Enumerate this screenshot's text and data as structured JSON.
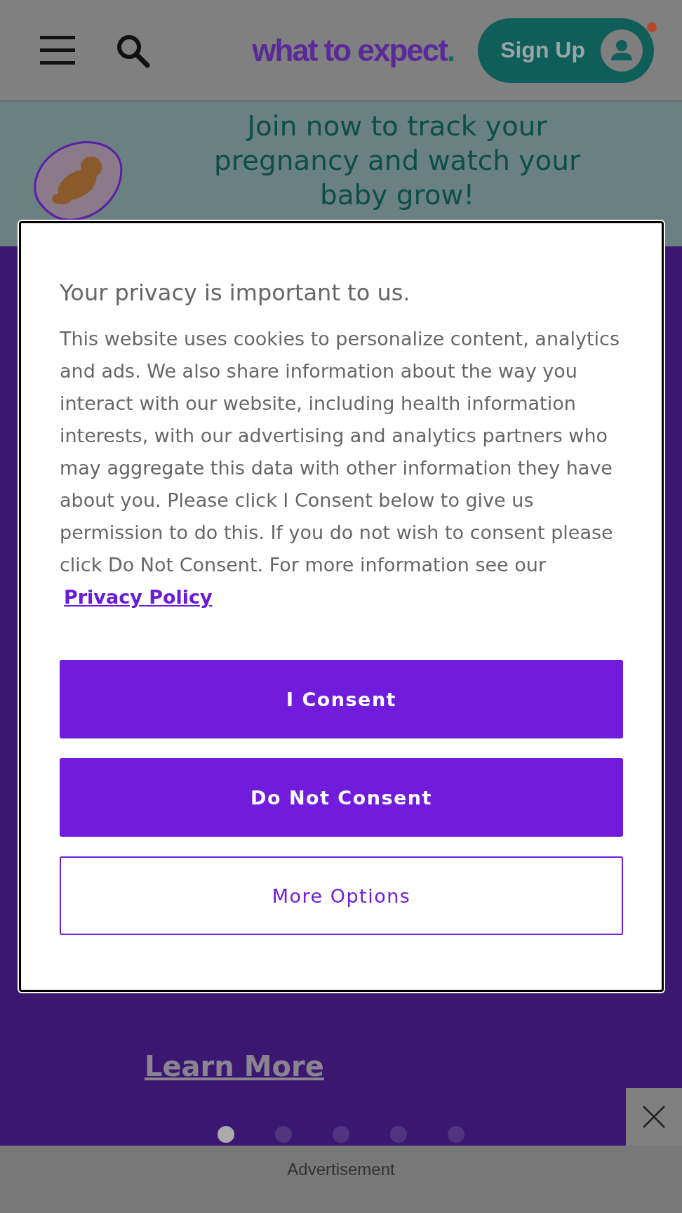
{
  "header": {
    "logo": "what to expect",
    "logo_dot": ".",
    "sign_up": "Sign Up",
    "notification": true
  },
  "banner": {
    "text": "Join now to track your pregnancy and watch your baby grow!"
  },
  "hero": {
    "link": "Learn More",
    "dots": [
      {
        "selected": true
      },
      {
        "selected": false
      },
      {
        "selected": false
      },
      {
        "selected": false
      },
      {
        "selected": false
      }
    ]
  },
  "consent_dialog": {
    "title": "Your privacy is important to us.",
    "body": "This website uses cookies to personalize content, analytics and ads. We also share information about the way you interact with our website, including health information interests, with our advertising and analytics partners who may aggregate this data with other information they have about you. Please click I Consent below to give us permission to do this. If you do not wish to consent please click Do Not Consent. For more information see our",
    "policy_link": "Privacy Policy",
    "buttons": [
      {
        "label": "I Consent",
        "kind": "primary"
      },
      {
        "label": "Do Not Consent",
        "kind": "primary"
      },
      {
        "label": "More Options",
        "kind": "outline"
      }
    ]
  },
  "ad": {
    "label": "Advertisement"
  }
}
